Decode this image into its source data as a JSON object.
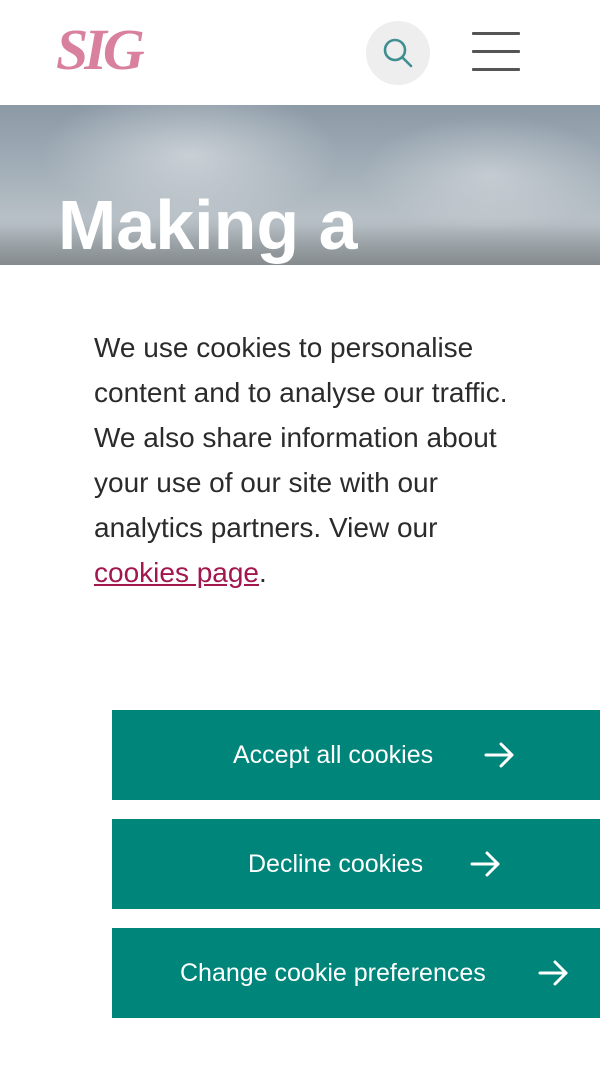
{
  "header": {
    "logo_text": "SIG",
    "brand_color": "#d9809f"
  },
  "hero": {
    "title": "Making a"
  },
  "cookie_banner": {
    "message": "We use cookies to personalise content and to analyse our traffic. We also share information about your use of our site with our analytics partners. View our ",
    "link_text": "cookies page",
    "message_end": ".",
    "link_color": "#a3174f",
    "buttons": [
      {
        "label": "Accept all cookies",
        "icon": "arrow-right-icon"
      },
      {
        "label": "Decline cookies",
        "icon": "arrow-right-icon"
      },
      {
        "label": "Change cookie preferences",
        "icon": "arrow-right-icon"
      }
    ],
    "button_color": "#00857a"
  },
  "icons": {
    "search": "search-icon",
    "menu": "hamburger-menu-icon"
  }
}
